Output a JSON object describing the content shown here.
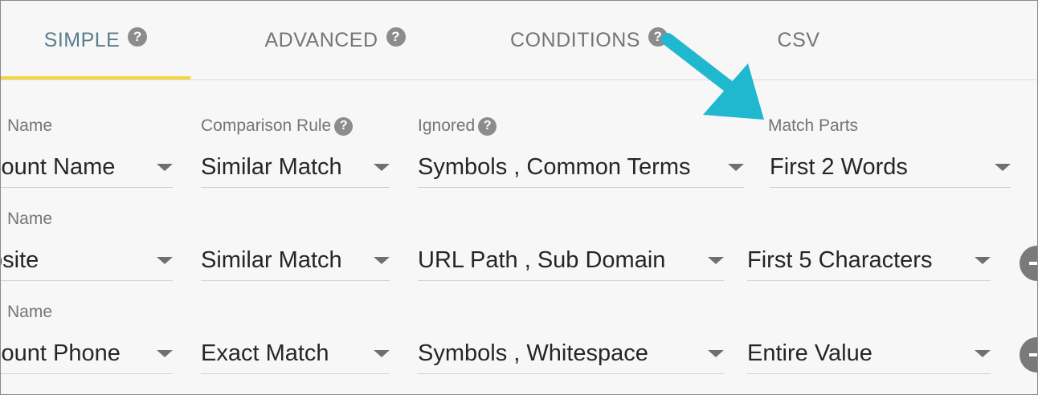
{
  "tabs": [
    {
      "label": "SIMPLE",
      "has_help": true,
      "active": true
    },
    {
      "label": "ADVANCED",
      "has_help": true,
      "active": false
    },
    {
      "label": "CONDITIONS",
      "has_help": true,
      "active": false
    },
    {
      "label": "CSV",
      "has_help": false,
      "active": false
    }
  ],
  "help_glyph": "?",
  "labels": {
    "field": "Name",
    "comparison": "Comparison Rule",
    "ignored": "Ignored",
    "match_parts": "Match Parts"
  },
  "rows": [
    {
      "field": "count Name",
      "comparison": "Similar Match",
      "ignored": "Symbols , Common Terms",
      "match_parts": "First 2 Words"
    },
    {
      "field": "bsite",
      "comparison": "Similar Match",
      "ignored": "URL Path , Sub Domain",
      "match_parts": "First 5 Characters"
    },
    {
      "field": "count Phone",
      "comparison": "Exact Match",
      "ignored": "Symbols , Whitespace",
      "match_parts": "Entire Value"
    }
  ],
  "colors": {
    "active_tab": "#5a7d8e",
    "tab_indicator": "#f5d442",
    "callout_arrow": "#1fb8cf"
  },
  "icons": {
    "help": "question-circle-icon",
    "dropdown": "caret-down-icon",
    "remove": "minus-circle-icon",
    "callout": "arrow-icon"
  }
}
